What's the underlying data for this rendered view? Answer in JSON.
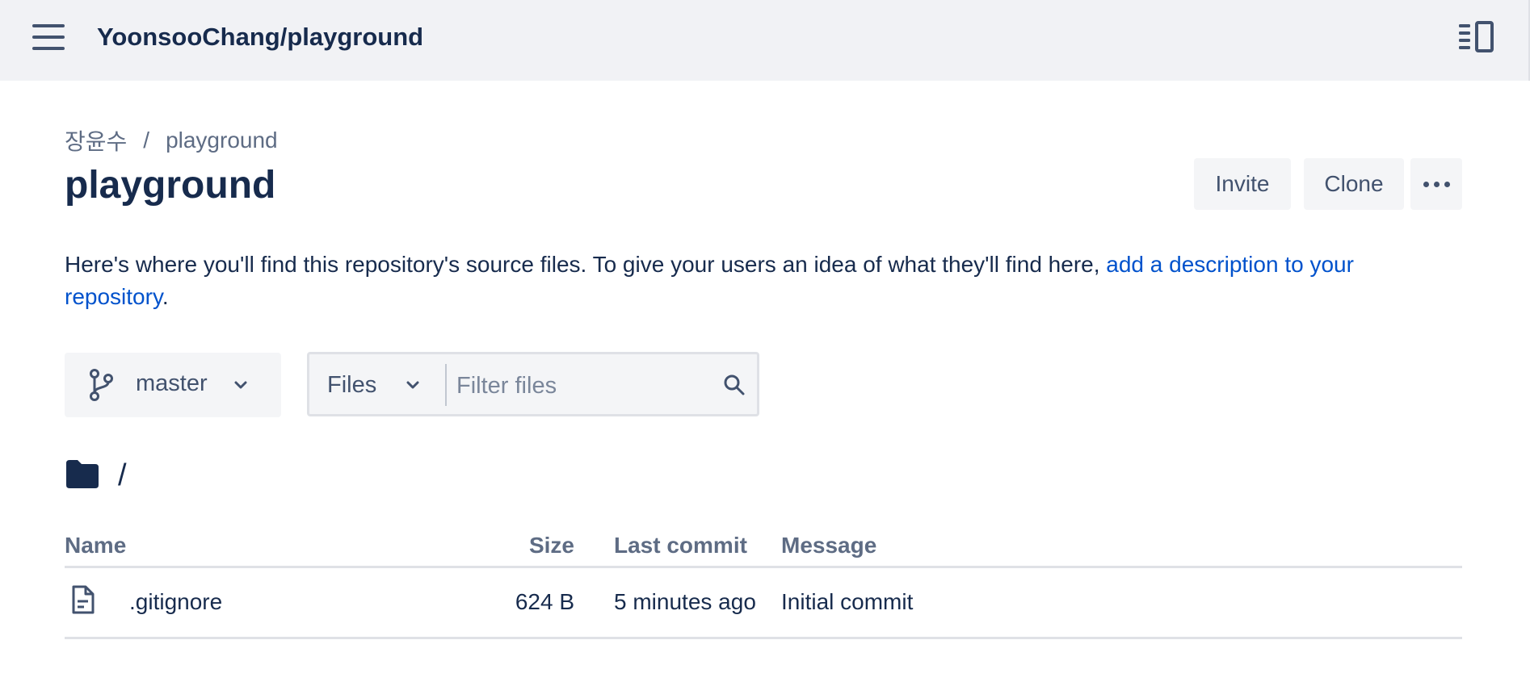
{
  "header": {
    "repo_title": "YoonsooChang/playground"
  },
  "breadcrumb": {
    "owner": "장윤수",
    "separator": "/",
    "repo": "playground"
  },
  "page": {
    "title": "playground"
  },
  "actions": {
    "invite_label": "Invite",
    "clone_label": "Clone"
  },
  "description": {
    "text": "Here's where you'll find this repository's source files. To give your users an idea of what they'll find here, ",
    "link_text": "add a description to your repository",
    "suffix": "."
  },
  "branch_selector": {
    "value": "master"
  },
  "file_filter": {
    "mode": "Files",
    "placeholder": "Filter files"
  },
  "path": {
    "label": "/"
  },
  "table": {
    "headers": {
      "name": "Name",
      "size": "Size",
      "last_commit": "Last commit",
      "message": "Message"
    },
    "rows": [
      {
        "name": ".gitignore",
        "size": "624 B",
        "last_commit": "5 minutes ago",
        "message": "Initial commit"
      }
    ]
  },
  "colors": {
    "link": "#0052cc",
    "text": "#172b4d",
    "muted": "#5e6c84",
    "topbar_bg": "#f1f2f5"
  }
}
